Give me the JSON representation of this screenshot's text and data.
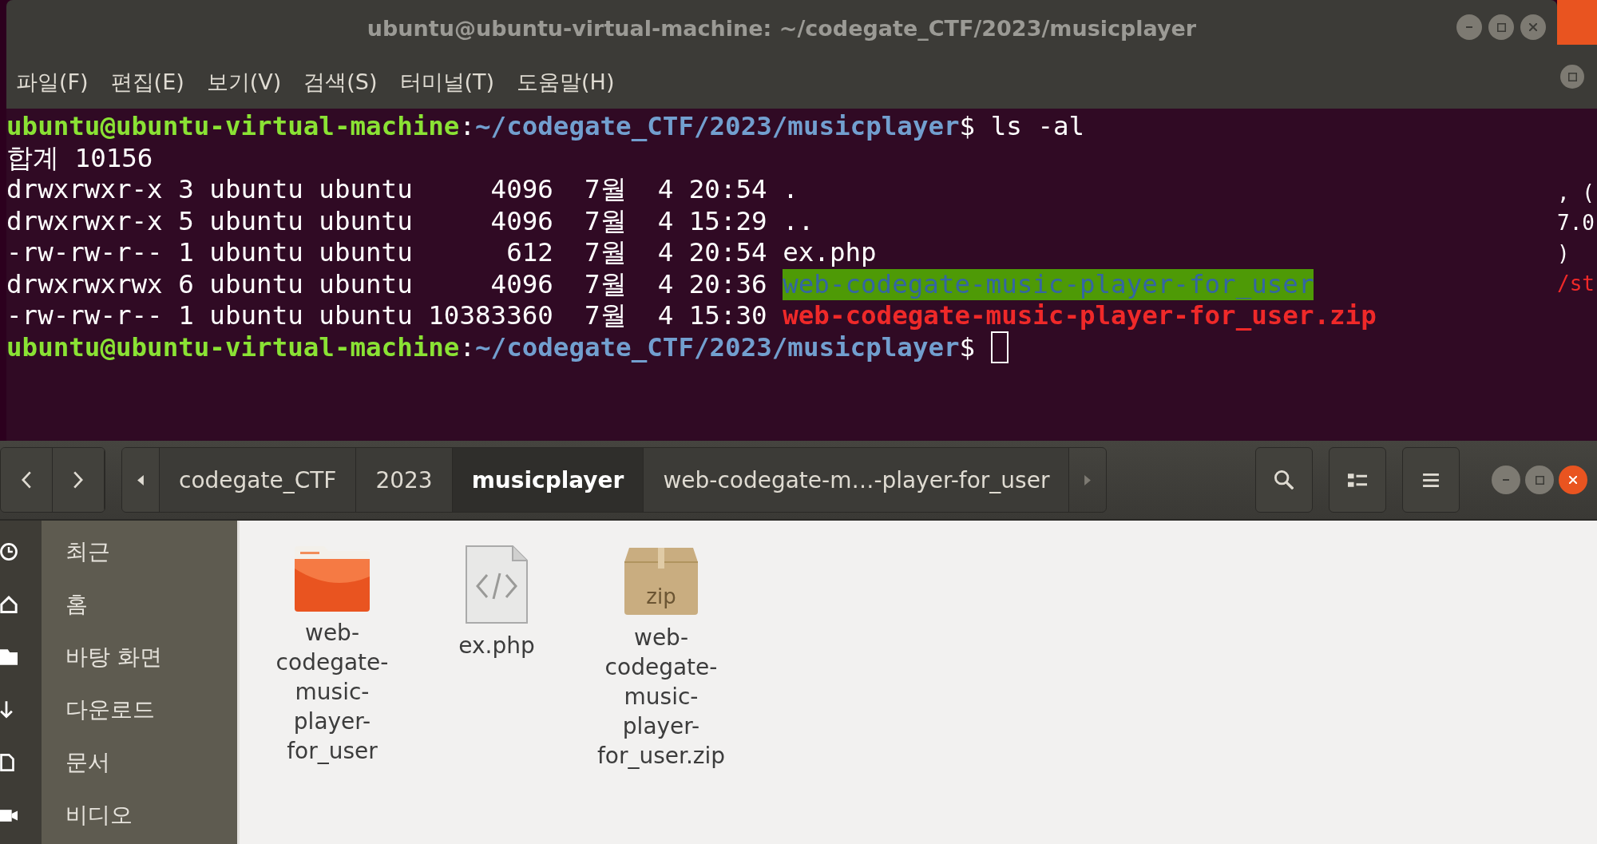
{
  "terminal": {
    "title": "ubuntu@ubuntu-virtual-machine: ~/codegate_CTF/2023/musicplayer",
    "menu": [
      "파일(F)",
      "편집(E)",
      "보기(V)",
      "검색(S)",
      "터미널(T)",
      "도움말(H)"
    ],
    "lines": [
      [
        {
          "kind": "user",
          "text": "ubuntu@ubuntu-virtual-machine"
        },
        {
          "kind": "plain",
          "text": ":"
        },
        {
          "kind": "path",
          "text": "~/codegate_CTF/2023/musicplayer"
        },
        {
          "kind": "plain",
          "text": "$ ls -al"
        }
      ],
      [
        {
          "kind": "plain",
          "text": "합계 10156"
        }
      ],
      [
        {
          "kind": "plain",
          "text": "drwxrwxr-x 3 ubuntu ubuntu     4096  7월  4 20:54 ."
        }
      ],
      [
        {
          "kind": "plain",
          "text": "drwxrwxr-x 5 ubuntu ubuntu     4096  7월  4 15:29 .."
        }
      ],
      [
        {
          "kind": "plain",
          "text": "-rw-rw-r-- 1 ubuntu ubuntu      612  7월  4 20:54 ex.php"
        }
      ],
      [
        {
          "kind": "plain",
          "text": "drwxrwxrwx 6 ubuntu ubuntu     4096  7월  4 20:36 "
        },
        {
          "kind": "shared_dir",
          "text": "web-codegate-music-player-for_user"
        }
      ],
      [
        {
          "kind": "plain",
          "text": "-rw-rw-r-- 1 ubuntu ubuntu 10383360  7월  4 15:30 "
        },
        {
          "kind": "archive",
          "text": "web-codegate-music-player-for_user.zip"
        }
      ],
      [
        {
          "kind": "user",
          "text": "ubuntu@ubuntu-virtual-machine"
        },
        {
          "kind": "plain",
          "text": ":"
        },
        {
          "kind": "path",
          "text": "~/codegate_CTF/2023/musicplayer"
        },
        {
          "kind": "plain",
          "text": "$ "
        },
        {
          "kind": "cursor"
        }
      ]
    ]
  },
  "background_window": {
    "fragments": [
      {
        "kind": "plain",
        "text": ", ("
      },
      {
        "kind": "plain",
        "text": "7.0"
      },
      {
        "kind": "plain",
        "text": ")"
      },
      {
        "kind": "error",
        "text": "/st"
      }
    ]
  },
  "file_manager": {
    "breadcrumbs": [
      {
        "label": "codegate_CTF",
        "selected": false
      },
      {
        "label": "2023",
        "selected": false
      },
      {
        "label": "musicplayer",
        "selected": true
      },
      {
        "label": "web-codegate-m…-player-for_user",
        "selected": false
      }
    ],
    "sidebar": [
      {
        "label": "최근",
        "kind": "recent"
      },
      {
        "label": "홈",
        "kind": "home"
      },
      {
        "label": "바탕 화면",
        "kind": "desktop"
      },
      {
        "label": "다운로드",
        "kind": "downloads"
      },
      {
        "label": "문서",
        "kind": "documents"
      },
      {
        "label": "비디오",
        "kind": "videos"
      }
    ],
    "files": [
      {
        "name": "web-codegate-music-player-for_user",
        "kind": "folder"
      },
      {
        "name": "ex.php",
        "kind": "code"
      },
      {
        "name": "web-codegate-music-player-for_user.zip",
        "kind": "zip"
      }
    ]
  }
}
